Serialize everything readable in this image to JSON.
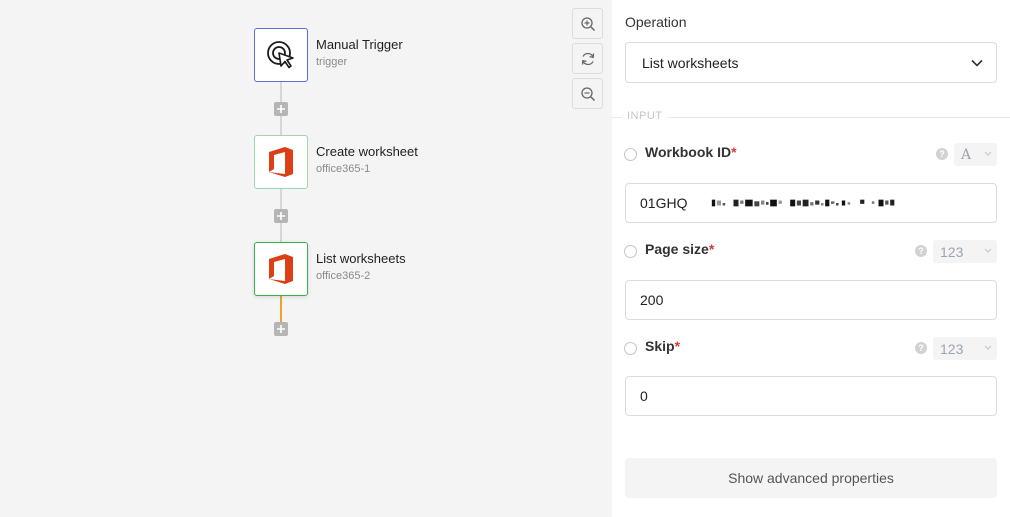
{
  "flow": {
    "nodes": [
      {
        "title": "Manual Trigger",
        "subtitle": "trigger",
        "icon": "cursor-click-icon"
      },
      {
        "title": "Create worksheet",
        "subtitle": "office365-1",
        "icon": "office365-icon"
      },
      {
        "title": "List worksheets",
        "subtitle": "office365-2",
        "icon": "office365-icon"
      }
    ],
    "colors": {
      "trigger_border": "#5b6fd6",
      "node_border": "#9fd6ad",
      "selected_border": "#37b24d",
      "active_connector": "#f0a030",
      "office_red": "#dc3e15"
    }
  },
  "zoom_controls": [
    "zoom-in-icon",
    "refresh-icon",
    "zoom-out-icon"
  ],
  "panel": {
    "operation_label": "Operation",
    "operation_value": "List worksheets",
    "section_label": "INPUT",
    "fields": [
      {
        "label": "Workbook ID",
        "required": "*",
        "type": "A",
        "value": "01GHQ"
      },
      {
        "label": "Page size",
        "required": "*",
        "type": "123",
        "value": "200"
      },
      {
        "label": "Skip",
        "required": "*",
        "type": "123",
        "value": "0"
      }
    ],
    "help_glyph": "?",
    "advanced_button": "Show advanced properties"
  }
}
